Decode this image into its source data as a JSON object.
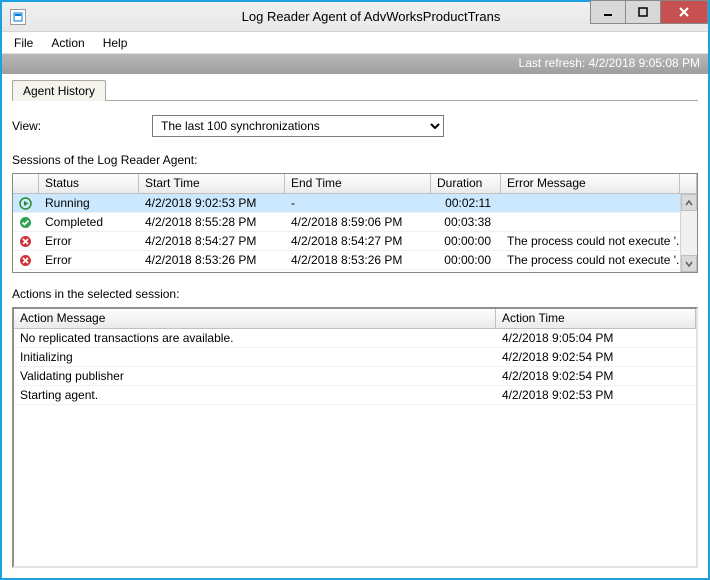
{
  "window": {
    "title": "Log Reader Agent of AdvWorksProductTrans"
  },
  "menu": {
    "file": "File",
    "action": "Action",
    "help": "Help"
  },
  "status_strip": "Last refresh: 4/2/2018 9:05:08 PM",
  "tab": {
    "history": "Agent History"
  },
  "view": {
    "label": "View:",
    "selected": "The last 100 synchronizations"
  },
  "sessions": {
    "label": "Sessions of the Log Reader Agent:",
    "headers": {
      "status": "Status",
      "start": "Start Time",
      "end": "End Time",
      "duration": "Duration",
      "error": "Error Message"
    },
    "rows": [
      {
        "icon": "running",
        "status": "Running",
        "start": "4/2/2018 9:02:53 PM",
        "end": "-",
        "duration": "00:02:11",
        "error": ""
      },
      {
        "icon": "completed",
        "status": "Completed",
        "start": "4/2/2018 8:55:28 PM",
        "end": "4/2/2018 8:59:06 PM",
        "duration": "00:03:38",
        "error": ""
      },
      {
        "icon": "error",
        "status": "Error",
        "start": "4/2/2018 8:54:27 PM",
        "end": "4/2/2018 8:54:27 PM",
        "duration": "00:00:00",
        "error": "The process could not execute '..."
      },
      {
        "icon": "error",
        "status": "Error",
        "start": "4/2/2018 8:53:26 PM",
        "end": "4/2/2018 8:53:26 PM",
        "duration": "00:00:00",
        "error": "The process could not execute '..."
      }
    ]
  },
  "actions": {
    "label": "Actions in the selected session:",
    "headers": {
      "msg": "Action Message",
      "time": "Action Time"
    },
    "rows": [
      {
        "msg": "No replicated transactions are available.",
        "time": "4/2/2018 9:05:04 PM"
      },
      {
        "msg": "Initializing",
        "time": "4/2/2018 9:02:54 PM"
      },
      {
        "msg": "Validating publisher",
        "time": "4/2/2018 9:02:54 PM"
      },
      {
        "msg": "Starting agent.",
        "time": "4/2/2018 9:02:53 PM"
      }
    ]
  }
}
